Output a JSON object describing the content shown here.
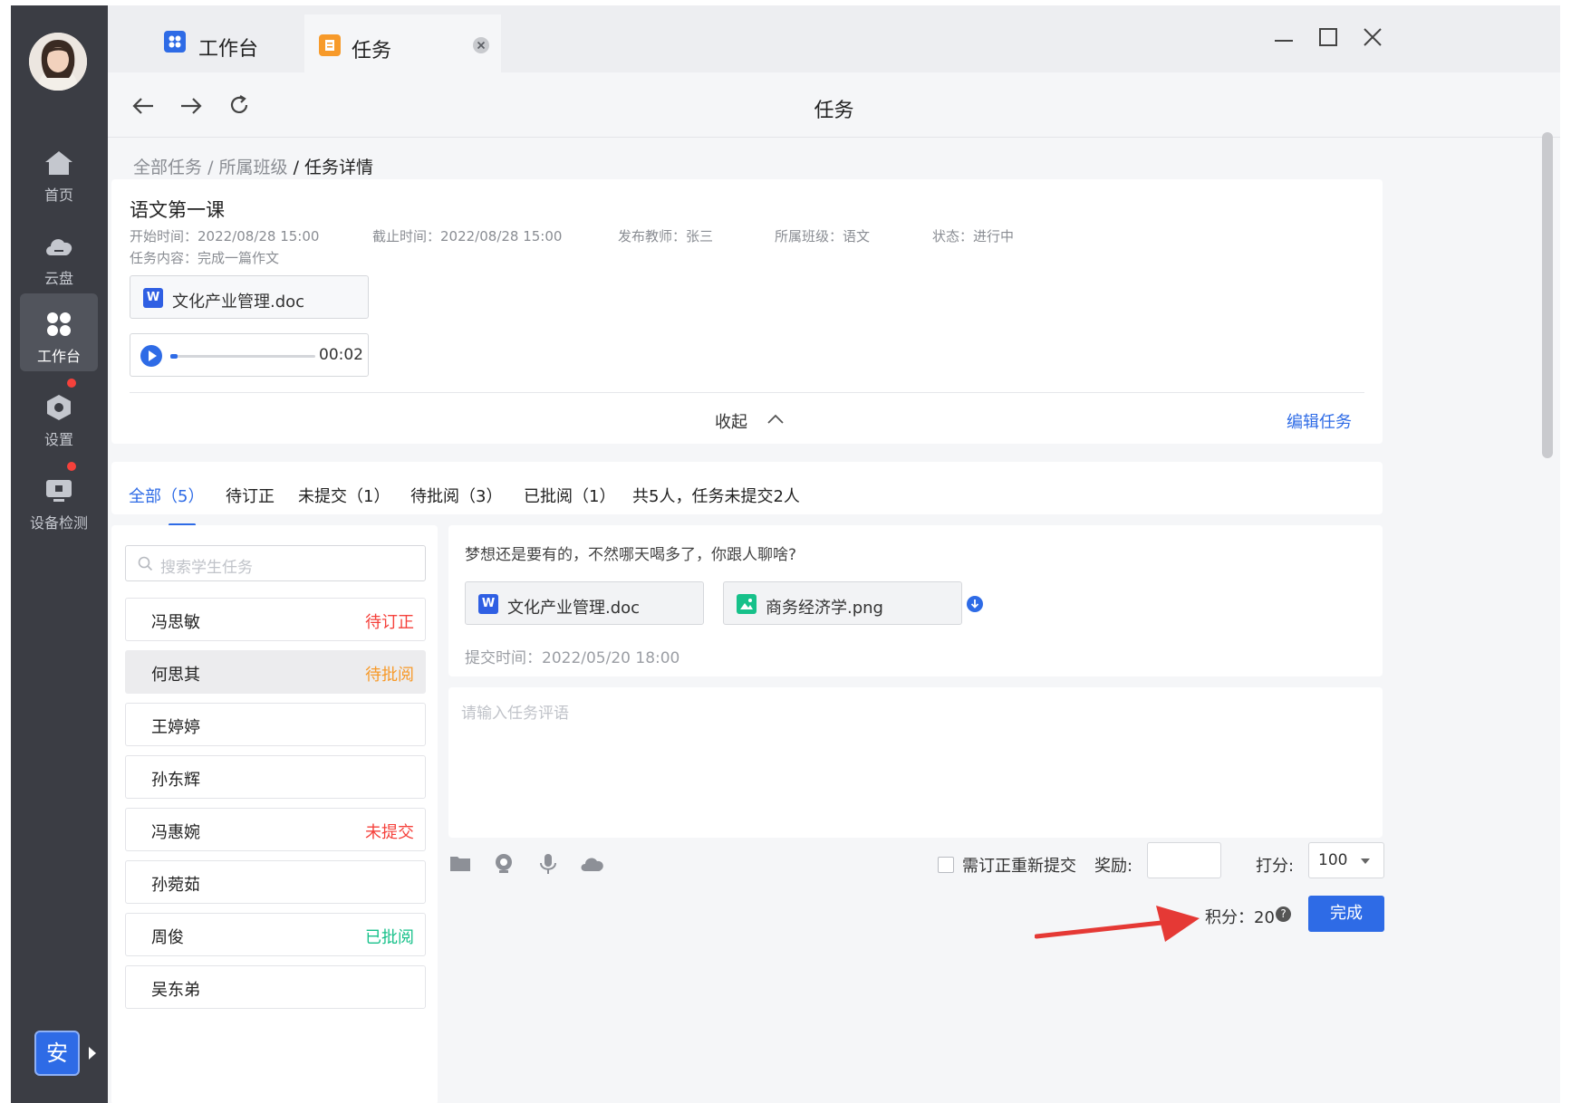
{
  "sidebar": {
    "items": [
      {
        "label": "首页",
        "icon": "home-icon"
      },
      {
        "label": "云盘",
        "icon": "cloud-icon"
      },
      {
        "label": "工作台",
        "icon": "workbench-icon"
      },
      {
        "label": "设置",
        "icon": "settings-icon"
      },
      {
        "label": "设备检测",
        "icon": "device-check-icon"
      }
    ],
    "active": "工作台",
    "user_badge": "安"
  },
  "tabs": [
    {
      "label": "工作台",
      "icon": "workbench-icon"
    },
    {
      "label": "任务",
      "icon": "task-icon"
    }
  ],
  "toolbar": {
    "title": "任务"
  },
  "breadcrumb": {
    "items": [
      "全部任务",
      "所属班级",
      "任务详情"
    ],
    "separator": "/"
  },
  "task": {
    "title": "语文第一课",
    "start": "开始时间：2022/08/28 15:00",
    "end": "截止时间：2022/08/28 15:00",
    "teacher": "发布教师：张三",
    "class": "所属班级：语文",
    "status": "状态：进行中",
    "content": "任务内容：完成一篇作文",
    "attachment": "文化产业管理.doc",
    "audio_time": "00:02",
    "audio_progress": 0.05,
    "collapse": "收起",
    "edit": "编辑任务"
  },
  "filter": {
    "tabs": [
      "全部（5）",
      "待订正",
      "未提交（1）",
      "待批阅（3）",
      "已批阅（1）"
    ],
    "summary": "共5人，任务未提交2人"
  },
  "students": {
    "search_placeholder": "搜索学生任务",
    "list": [
      {
        "name": "冯思敏",
        "status": "待订正"
      },
      {
        "name": "何思其",
        "status": "待批阅"
      },
      {
        "name": "王婷婷",
        "status": ""
      },
      {
        "name": "孙东辉",
        "status": ""
      },
      {
        "name": "冯惠婉",
        "status": "未提交"
      },
      {
        "name": "孙菀茹",
        "status": ""
      },
      {
        "name": "周俊",
        "status": "已批阅"
      },
      {
        "name": "吴东弟",
        "status": ""
      }
    ]
  },
  "submission": {
    "text": "梦想还是要有的，不然哪天喝多了，你跟人聊啥?",
    "files": [
      "文化产业管理.doc",
      "商务经济学.png"
    ],
    "time": "提交时间：2022/05/20 18:00"
  },
  "review": {
    "comment_placeholder": "请输入任务评语",
    "resubmit_label": "需订正重新提交",
    "reward_label": "奖励:",
    "score_label": "打分:",
    "score_value": "100",
    "points_label": "积分：",
    "points_value": "20",
    "done": "完成"
  },
  "colors": {
    "accent": "#2e6be6",
    "sidebar": "#3b3d44",
    "status_red": "#f5413b",
    "status_orange": "#f79a2a",
    "status_green": "#17c18a"
  }
}
